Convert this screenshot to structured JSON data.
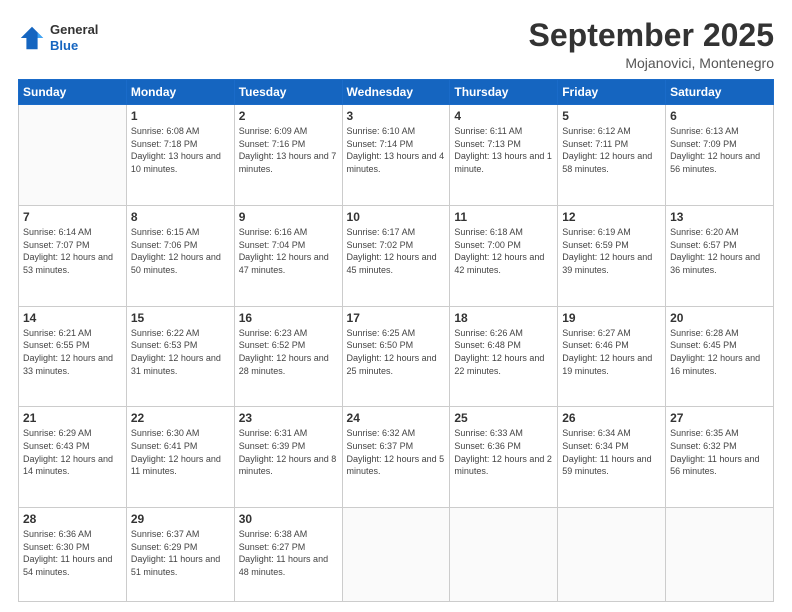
{
  "header": {
    "logo": {
      "line1": "General",
      "line2": "Blue"
    },
    "title": "September 2025",
    "location": "Mojanovici, Montenegro"
  },
  "calendar": {
    "days_of_week": [
      "Sunday",
      "Monday",
      "Tuesday",
      "Wednesday",
      "Thursday",
      "Friday",
      "Saturday"
    ],
    "weeks": [
      [
        {
          "day": "",
          "sunrise": "",
          "sunset": "",
          "daylight": "",
          "empty": true
        },
        {
          "day": "1",
          "sunrise": "Sunrise: 6:08 AM",
          "sunset": "Sunset: 7:18 PM",
          "daylight": "Daylight: 13 hours and 10 minutes."
        },
        {
          "day": "2",
          "sunrise": "Sunrise: 6:09 AM",
          "sunset": "Sunset: 7:16 PM",
          "daylight": "Daylight: 13 hours and 7 minutes."
        },
        {
          "day": "3",
          "sunrise": "Sunrise: 6:10 AM",
          "sunset": "Sunset: 7:14 PM",
          "daylight": "Daylight: 13 hours and 4 minutes."
        },
        {
          "day": "4",
          "sunrise": "Sunrise: 6:11 AM",
          "sunset": "Sunset: 7:13 PM",
          "daylight": "Daylight: 13 hours and 1 minute."
        },
        {
          "day": "5",
          "sunrise": "Sunrise: 6:12 AM",
          "sunset": "Sunset: 7:11 PM",
          "daylight": "Daylight: 12 hours and 58 minutes."
        },
        {
          "day": "6",
          "sunrise": "Sunrise: 6:13 AM",
          "sunset": "Sunset: 7:09 PM",
          "daylight": "Daylight: 12 hours and 56 minutes."
        }
      ],
      [
        {
          "day": "7",
          "sunrise": "Sunrise: 6:14 AM",
          "sunset": "Sunset: 7:07 PM",
          "daylight": "Daylight: 12 hours and 53 minutes."
        },
        {
          "day": "8",
          "sunrise": "Sunrise: 6:15 AM",
          "sunset": "Sunset: 7:06 PM",
          "daylight": "Daylight: 12 hours and 50 minutes."
        },
        {
          "day": "9",
          "sunrise": "Sunrise: 6:16 AM",
          "sunset": "Sunset: 7:04 PM",
          "daylight": "Daylight: 12 hours and 47 minutes."
        },
        {
          "day": "10",
          "sunrise": "Sunrise: 6:17 AM",
          "sunset": "Sunset: 7:02 PM",
          "daylight": "Daylight: 12 hours and 45 minutes."
        },
        {
          "day": "11",
          "sunrise": "Sunrise: 6:18 AM",
          "sunset": "Sunset: 7:00 PM",
          "daylight": "Daylight: 12 hours and 42 minutes."
        },
        {
          "day": "12",
          "sunrise": "Sunrise: 6:19 AM",
          "sunset": "Sunset: 6:59 PM",
          "daylight": "Daylight: 12 hours and 39 minutes."
        },
        {
          "day": "13",
          "sunrise": "Sunrise: 6:20 AM",
          "sunset": "Sunset: 6:57 PM",
          "daylight": "Daylight: 12 hours and 36 minutes."
        }
      ],
      [
        {
          "day": "14",
          "sunrise": "Sunrise: 6:21 AM",
          "sunset": "Sunset: 6:55 PM",
          "daylight": "Daylight: 12 hours and 33 minutes."
        },
        {
          "day": "15",
          "sunrise": "Sunrise: 6:22 AM",
          "sunset": "Sunset: 6:53 PM",
          "daylight": "Daylight: 12 hours and 31 minutes."
        },
        {
          "day": "16",
          "sunrise": "Sunrise: 6:23 AM",
          "sunset": "Sunset: 6:52 PM",
          "daylight": "Daylight: 12 hours and 28 minutes."
        },
        {
          "day": "17",
          "sunrise": "Sunrise: 6:25 AM",
          "sunset": "Sunset: 6:50 PM",
          "daylight": "Daylight: 12 hours and 25 minutes."
        },
        {
          "day": "18",
          "sunrise": "Sunrise: 6:26 AM",
          "sunset": "Sunset: 6:48 PM",
          "daylight": "Daylight: 12 hours and 22 minutes."
        },
        {
          "day": "19",
          "sunrise": "Sunrise: 6:27 AM",
          "sunset": "Sunset: 6:46 PM",
          "daylight": "Daylight: 12 hours and 19 minutes."
        },
        {
          "day": "20",
          "sunrise": "Sunrise: 6:28 AM",
          "sunset": "Sunset: 6:45 PM",
          "daylight": "Daylight: 12 hours and 16 minutes."
        }
      ],
      [
        {
          "day": "21",
          "sunrise": "Sunrise: 6:29 AM",
          "sunset": "Sunset: 6:43 PM",
          "daylight": "Daylight: 12 hours and 14 minutes."
        },
        {
          "day": "22",
          "sunrise": "Sunrise: 6:30 AM",
          "sunset": "Sunset: 6:41 PM",
          "daylight": "Daylight: 12 hours and 11 minutes."
        },
        {
          "day": "23",
          "sunrise": "Sunrise: 6:31 AM",
          "sunset": "Sunset: 6:39 PM",
          "daylight": "Daylight: 12 hours and 8 minutes."
        },
        {
          "day": "24",
          "sunrise": "Sunrise: 6:32 AM",
          "sunset": "Sunset: 6:37 PM",
          "daylight": "Daylight: 12 hours and 5 minutes."
        },
        {
          "day": "25",
          "sunrise": "Sunrise: 6:33 AM",
          "sunset": "Sunset: 6:36 PM",
          "daylight": "Daylight: 12 hours and 2 minutes."
        },
        {
          "day": "26",
          "sunrise": "Sunrise: 6:34 AM",
          "sunset": "Sunset: 6:34 PM",
          "daylight": "Daylight: 11 hours and 59 minutes."
        },
        {
          "day": "27",
          "sunrise": "Sunrise: 6:35 AM",
          "sunset": "Sunset: 6:32 PM",
          "daylight": "Daylight: 11 hours and 56 minutes."
        }
      ],
      [
        {
          "day": "28",
          "sunrise": "Sunrise: 6:36 AM",
          "sunset": "Sunset: 6:30 PM",
          "daylight": "Daylight: 11 hours and 54 minutes."
        },
        {
          "day": "29",
          "sunrise": "Sunrise: 6:37 AM",
          "sunset": "Sunset: 6:29 PM",
          "daylight": "Daylight: 11 hours and 51 minutes."
        },
        {
          "day": "30",
          "sunrise": "Sunrise: 6:38 AM",
          "sunset": "Sunset: 6:27 PM",
          "daylight": "Daylight: 11 hours and 48 minutes."
        },
        {
          "day": "",
          "sunrise": "",
          "sunset": "",
          "daylight": "",
          "empty": true
        },
        {
          "day": "",
          "sunrise": "",
          "sunset": "",
          "daylight": "",
          "empty": true
        },
        {
          "day": "",
          "sunrise": "",
          "sunset": "",
          "daylight": "",
          "empty": true
        },
        {
          "day": "",
          "sunrise": "",
          "sunset": "",
          "daylight": "",
          "empty": true
        }
      ]
    ]
  }
}
